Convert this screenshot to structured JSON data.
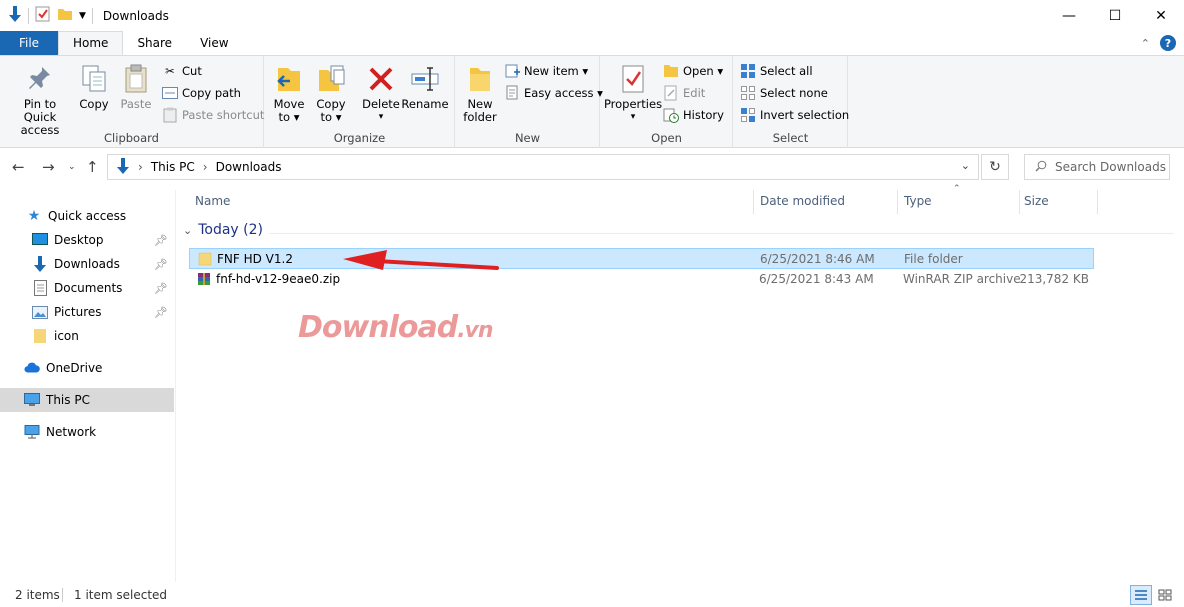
{
  "window": {
    "title": "Downloads",
    "minimize": "—",
    "maximize": "☐",
    "close": "✕"
  },
  "tabs": {
    "file": "File",
    "home": "Home",
    "share": "Share",
    "view": "View",
    "help": "?"
  },
  "ribbon": {
    "clipboard": {
      "label": "Clipboard",
      "pin_line1": "Pin to Quick",
      "pin_line2": "access",
      "copy": "Copy",
      "paste": "Paste",
      "cut": "Cut",
      "copy_path": "Copy path",
      "paste_shortcut": "Paste shortcut"
    },
    "organize": {
      "label": "Organize",
      "move_line1": "Move",
      "move_line2": "to ▾",
      "copy_line1": "Copy",
      "copy_line2": "to ▾",
      "delete": "Delete",
      "delete_arrow": "▾",
      "rename": "Rename"
    },
    "new": {
      "label": "New",
      "folder_line1": "New",
      "folder_line2": "folder",
      "new_item": "New item ▾",
      "easy_access": "Easy access ▾"
    },
    "open": {
      "label": "Open",
      "properties": "Properties",
      "properties_arrow": "▾",
      "open": "Open ▾",
      "edit": "Edit",
      "history": "History"
    },
    "select": {
      "label": "Select",
      "select_all": "Select all",
      "select_none": "Select none",
      "invert": "Invert selection"
    }
  },
  "address": {
    "crumbs": [
      "This PC",
      "Downloads"
    ],
    "search_placeholder": "Search Downloads"
  },
  "nav": {
    "quick_access": "Quick access",
    "items": [
      {
        "label": "Desktop",
        "pinned": true
      },
      {
        "label": "Downloads",
        "pinned": true
      },
      {
        "label": "Documents",
        "pinned": true
      },
      {
        "label": "Pictures",
        "pinned": true
      },
      {
        "label": "icon",
        "pinned": false
      }
    ],
    "onedrive": "OneDrive",
    "this_pc": "This PC",
    "network": "Network"
  },
  "columns": {
    "name": "Name",
    "date": "Date modified",
    "type": "Type",
    "size": "Size"
  },
  "group": {
    "label": "Today (2)"
  },
  "files": [
    {
      "name": "FNF HD V1.2",
      "date": "6/25/2021 8:46 AM",
      "type": "File folder",
      "size": "",
      "selected": true
    },
    {
      "name": "fnf-hd-v12-9eae0.zip",
      "date": "6/25/2021 8:43 AM",
      "type": "WinRAR ZIP archive",
      "size": "213,782 KB",
      "selected": false
    }
  ],
  "watermark": {
    "main": "Download",
    "suffix": ".vn"
  },
  "status": {
    "count": "2 items",
    "selected": "1 item selected"
  },
  "colors": {
    "accent": "#1a67b3",
    "selection": "#cce8ff",
    "arrow": "#e02020",
    "folder": "#f5c542"
  }
}
